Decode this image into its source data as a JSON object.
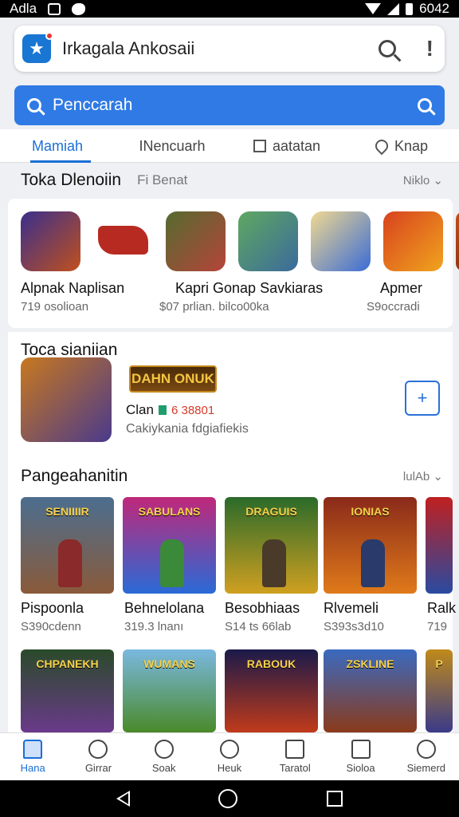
{
  "status": {
    "left": "Adla",
    "right": "6042"
  },
  "appbar": {
    "title": "Irkagala Ankosaii"
  },
  "search": {
    "placeholder": "Penccarah"
  },
  "tabs": [
    {
      "label": "Mamiah"
    },
    {
      "label": "INencuarh"
    },
    {
      "label": "aatatan"
    },
    {
      "label": "Knap"
    }
  ],
  "section1": {
    "title": "Toka Dlenoiin",
    "subtitle": "Fi Benat",
    "more": "Niklo"
  },
  "apps": [
    {
      "name": "Alpnak Naplisan",
      "sub": "719 osolioan"
    },
    {
      "name": "Kapri Gonap Savkiaras",
      "sub": "$07 prlian. bilco00ka"
    },
    {
      "name": "Apmer",
      "sub": "S9occradi"
    }
  ],
  "featured": {
    "title": "Toca sianiian",
    "logo_text": "DAHN ONUK",
    "name": "Clan",
    "price": "6 38801",
    "desc": "Cakiykania fdgiafiekis"
  },
  "section3": {
    "title": "Pangeahanitin",
    "more": "lulAb"
  },
  "games_row1": [
    {
      "tile": "SENIIIIR",
      "name": "Pispoonla",
      "sub": "S390cdenn"
    },
    {
      "tile": "SABULANS",
      "name": "Behnelolana",
      "sub": "319.3 lnanı"
    },
    {
      "tile": "DRAGUIS",
      "name": "Besobhiaas",
      "sub": "S14 ts 66lab"
    },
    {
      "tile": "IONIAS",
      "name": "Rlvemeli",
      "sub": "S393s3d10"
    },
    {
      "tile": "",
      "name": "Ralk",
      "sub": "719"
    }
  ],
  "games_row2": [
    {
      "tile": "CHPANEKH"
    },
    {
      "tile": "WUMANS"
    },
    {
      "tile": "RABOUK"
    },
    {
      "tile": "ZSKLINE"
    },
    {
      "tile": "P"
    }
  ],
  "bottom_nav": [
    {
      "label": "Hana"
    },
    {
      "label": "Girrar"
    },
    {
      "label": "Soak"
    },
    {
      "label": "Heuk"
    },
    {
      "label": "Taratol"
    },
    {
      "label": "Sioloa"
    },
    {
      "label": "Siemerd"
    }
  ],
  "colors": {
    "accent": "#2f7ae5",
    "tab_active": "#1a6fd6"
  }
}
